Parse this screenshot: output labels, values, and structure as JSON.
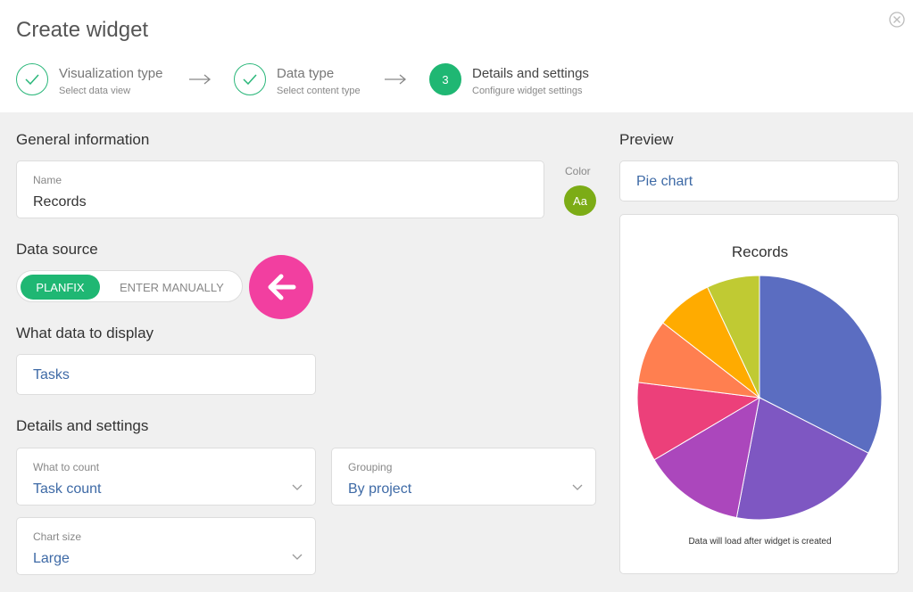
{
  "dialog": {
    "title": "Create widget"
  },
  "steps": [
    {
      "number": "",
      "title": "Visualization type",
      "subtitle": "Select data view",
      "state": "done"
    },
    {
      "number": "",
      "title": "Data type",
      "subtitle": "Select content type",
      "state": "done"
    },
    {
      "number": "3",
      "title": "Details and settings",
      "subtitle": "Configure widget settings",
      "state": "active"
    }
  ],
  "general": {
    "section_title": "General information",
    "name_label": "Name",
    "name_value": "Records",
    "color_label": "Color",
    "color_swatch_text": "Aa",
    "color_value": "#7cac16"
  },
  "data_source": {
    "section_title": "Data source",
    "options": [
      "PLANFIX",
      "ENTER MANUALLY"
    ],
    "selected": "PLANFIX"
  },
  "display": {
    "section_title": "What data to display",
    "value": "Tasks"
  },
  "details": {
    "section_title": "Details and settings",
    "count_label": "What to count",
    "count_value": "Task count",
    "grouping_label": "Grouping",
    "grouping_value": "By project",
    "size_label": "Chart size",
    "size_value": "Large"
  },
  "preview": {
    "section_title": "Preview",
    "chart_type_value": "Pie chart",
    "note": "Data will load after widget is created"
  },
  "colors": {
    "accent": "#1fb773",
    "link": "#3e6aa6",
    "pointer": "#f23fa0"
  },
  "chart_data": {
    "type": "pie",
    "title": "Records",
    "slices": [
      {
        "value": 32.5,
        "color": "#5b6dc1"
      },
      {
        "value": 20.5,
        "color": "#7e57c2"
      },
      {
        "value": 13.5,
        "color": "#ab47bc"
      },
      {
        "value": 10.5,
        "color": "#ec407a"
      },
      {
        "value": 8.5,
        "color": "#ff7f50"
      },
      {
        "value": 7.5,
        "color": "#ffab00"
      },
      {
        "value": 7.0,
        "color": "#c0ca33"
      }
    ]
  }
}
